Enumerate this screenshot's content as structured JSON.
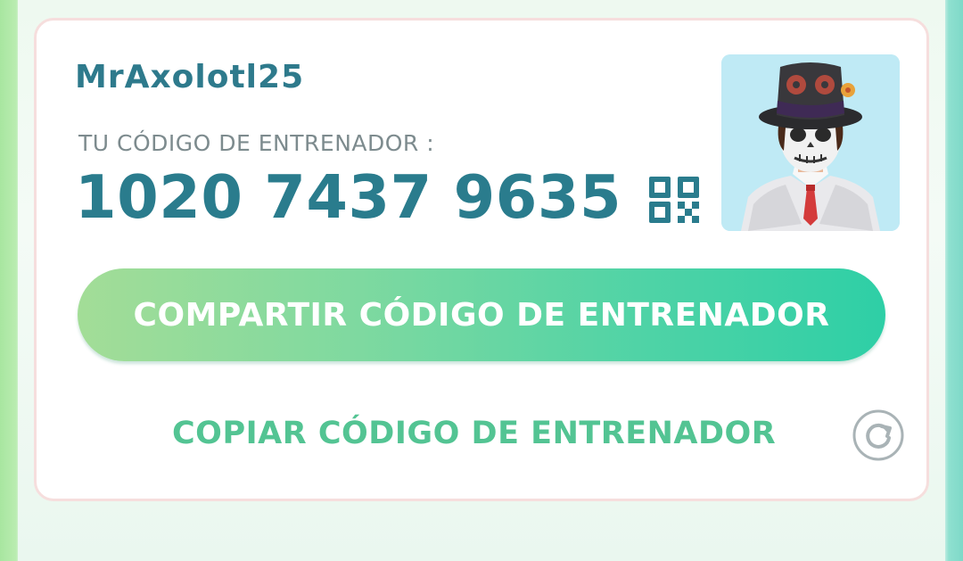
{
  "profile": {
    "username": "MrAxolotl25",
    "code_caption": "TU CÓDIGO DE ENTRENADOR :",
    "code": "1020 7437 9635"
  },
  "actions": {
    "share_label": "COMPARTIR CÓDIGO DE ENTRENADOR",
    "copy_label": "COPIAR CÓDIGO DE ENTRENADOR"
  },
  "icons": {
    "qr": "qr-code-icon",
    "refresh": "refresh-icon"
  },
  "colors": {
    "accent_teal": "#2a7c8d",
    "copy_green": "#53c493",
    "button_gradient_start": "#a3dd97",
    "button_gradient_end": "#2ecfa6",
    "card_border": "#f6dedd"
  }
}
